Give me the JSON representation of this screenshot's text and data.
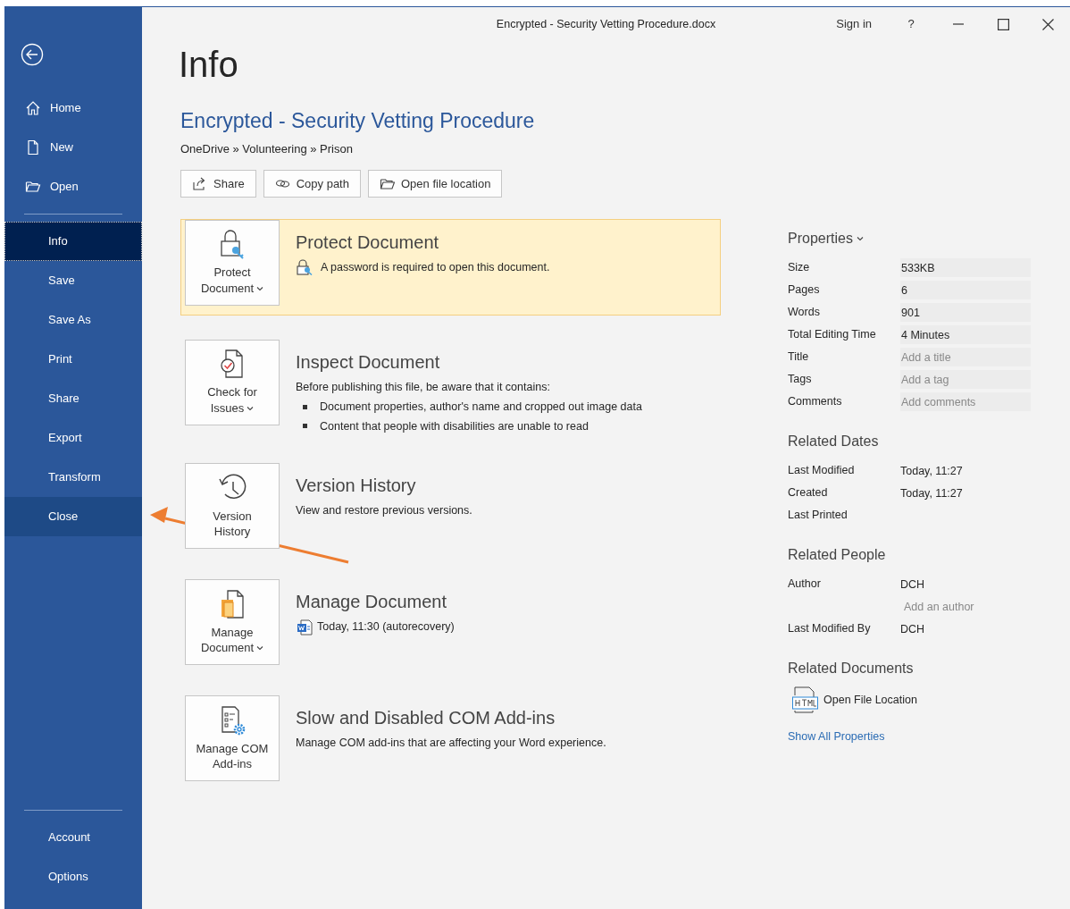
{
  "window": {
    "title": "Encrypted - Security Vetting Procedure.docx",
    "sign_in": "Sign in",
    "help": "?"
  },
  "sidebar": {
    "top_items": [
      {
        "label": "Home",
        "selected": false
      },
      {
        "label": "New",
        "selected": false
      },
      {
        "label": "Open",
        "selected": false
      }
    ],
    "items": [
      {
        "label": "Info",
        "selected": true,
        "hovered": false
      },
      {
        "label": "Save",
        "selected": false,
        "hovered": false
      },
      {
        "label": "Save As",
        "selected": false,
        "hovered": false
      },
      {
        "label": "Print",
        "selected": false,
        "hovered": false
      },
      {
        "label": "Share",
        "selected": false,
        "hovered": false
      },
      {
        "label": "Export",
        "selected": false,
        "hovered": false
      },
      {
        "label": "Transform",
        "selected": false,
        "hovered": false
      },
      {
        "label": "Close",
        "selected": false,
        "hovered": true
      }
    ],
    "bottom_items": [
      {
        "label": "Account",
        "selected": false
      },
      {
        "label": "Options",
        "selected": false
      }
    ]
  },
  "info": {
    "heading": "Info",
    "doc_title": "Encrypted - Security Vetting Procedure",
    "breadcrumb": "OneDrive » Volunteering » Prison",
    "actions": [
      {
        "label": "Share"
      },
      {
        "label": "Copy path"
      },
      {
        "label": "Open file location"
      }
    ],
    "sections": [
      {
        "tile_lines": [
          "Protect",
          "Document"
        ],
        "dropdown": true,
        "title": "Protect Document",
        "warning": true,
        "kind": "note",
        "description": "A password is required to open this document."
      },
      {
        "tile_lines": [
          "Check for",
          "Issues"
        ],
        "dropdown": true,
        "title": "Inspect Document",
        "warning": false,
        "kind": "plain",
        "description": "Before publishing this file, be aware that it contains:",
        "bullets": [
          "Document properties, author's name and cropped out image data",
          "Content that people with disabilities are unable to read"
        ]
      },
      {
        "tile_lines": [
          "Version",
          "History"
        ],
        "dropdown": false,
        "title": "Version History",
        "warning": false,
        "kind": "plain",
        "description": "View and restore previous versions."
      },
      {
        "tile_lines": [
          "Manage",
          "Document"
        ],
        "dropdown": true,
        "title": "Manage Document",
        "warning": false,
        "kind": "file",
        "description": "Today, 11:30 (autorecovery)"
      },
      {
        "tile_lines": [
          "Manage COM",
          "Add-ins"
        ],
        "dropdown": false,
        "title": "Slow and Disabled COM Add-ins",
        "warning": false,
        "kind": "plain",
        "description": "Manage COM add-ins that are affecting your Word experience."
      }
    ]
  },
  "properties": {
    "heading": "Properties",
    "rows": [
      {
        "label": "Size",
        "value": "533KB"
      },
      {
        "label": "Pages",
        "value": "6"
      },
      {
        "label": "Words",
        "value": "901"
      },
      {
        "label": "Total Editing Time",
        "value": "4 Minutes"
      },
      {
        "label": "Title",
        "placeholder": "Add a title"
      },
      {
        "label": "Tags",
        "placeholder": "Add a tag"
      },
      {
        "label": "Comments",
        "placeholder": "Add comments"
      }
    ]
  },
  "related_dates": {
    "heading": "Related Dates",
    "rows": [
      {
        "label": "Last Modified",
        "value": "Today, 11:27"
      },
      {
        "label": "Created",
        "value": "Today, 11:27"
      },
      {
        "label": "Last Printed"
      }
    ]
  },
  "related_people": {
    "heading": "Related People",
    "rows": [
      {
        "label": "Author",
        "value": "DCH",
        "placeholder": "Add an author"
      },
      {
        "label": "Last Modified By",
        "value": "DCH"
      }
    ]
  },
  "related_documents": {
    "heading": "Related Documents",
    "items": [
      {
        "label": "Open File Location"
      }
    ]
  },
  "show_all_link": "Show All Properties"
}
